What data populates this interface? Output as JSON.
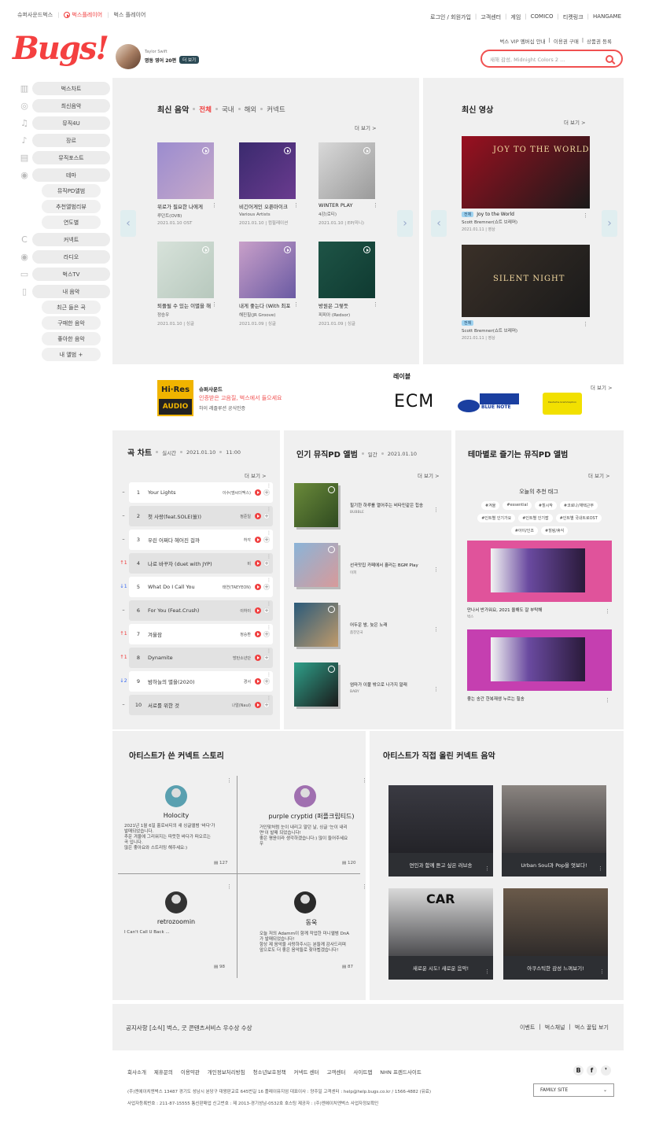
{
  "topnav": {
    "left": [
      "슈퍼사운드벅스",
      "벅스플레이어",
      "벅스 플레이어"
    ],
    "right": [
      "로그인 / 회원가입",
      "고객센터",
      "게임",
      "COMICO",
      "티켓링크",
      "HANGAME"
    ]
  },
  "logo": "Bugs!",
  "vip_links": [
    "벅스 VIP 멤버십 안내",
    "이용권 구매",
    "상품권 등록"
  ],
  "search": {
    "placeholder": "새해 감성, Midnight Colors 2 ..."
  },
  "artist_promo": {
    "name": "Taylor Swift",
    "title": "명동 영어 20편",
    "more": "더 보기"
  },
  "sidebar": [
    {
      "icon": "chart-icon",
      "label": "벅스차트"
    },
    {
      "icon": "disc-icon",
      "label": "최신음악"
    },
    {
      "icon": "note-icon",
      "label": "뮤직4U"
    },
    {
      "icon": "guitar-icon",
      "label": "장르"
    },
    {
      "icon": "post-icon",
      "label": "뮤직포스트"
    },
    {
      "icon": "theme-icon",
      "label": "테마"
    },
    {
      "sub": true,
      "label": "뮤직PD앨범"
    },
    {
      "sub": true,
      "label": "추천앨범리뷰"
    },
    {
      "sub": true,
      "label": "연도별"
    },
    {
      "icon": "connect-icon",
      "label": "커넥트"
    },
    {
      "icon": "radio-icon",
      "label": "라디오"
    },
    {
      "icon": "tv-icon",
      "label": "벅스TV"
    },
    {
      "icon": "folder-icon",
      "label": "내 음악"
    },
    {
      "sub": true,
      "label": "최근 들은 곡"
    },
    {
      "sub": true,
      "label": "구매한 음악"
    },
    {
      "sub": true,
      "label": "좋아한 음악"
    },
    {
      "sub": true,
      "label": "내 앨범 +"
    }
  ],
  "latest": {
    "title": "최신 음악",
    "tabs": [
      "전체",
      "국내",
      "해외",
      "커넥트"
    ],
    "more": "더 보기 >",
    "albums": [
      {
        "title": "위로가 필요한 나에게",
        "artist": "루던트(OVB)",
        "date": "2021.01.10 OST",
        "color1": "#9b8ccf",
        "color2": "#c7a9c9"
      },
      {
        "title": "비긴어게인 오픈마이크",
        "artist": "Various Artists",
        "date": "2021.01.10 | 컴필레이션",
        "color1": "#3a2a6e",
        "color2": "#6a3b8f"
      },
      {
        "title": "WINTER PLAY",
        "artist": "4강(로티)",
        "date": "2021.01.10 | EP(미니)",
        "color1": "#d9d9d9",
        "color2": "#9a9a9a"
      },
      {
        "title": "퇴플될 수 있는 이별을 해",
        "artist": "정승우",
        "date": "2021.01.10 | 싱글",
        "color1": "#d7e2da",
        "color2": "#b7c8bd"
      },
      {
        "title": "내게 좋는다 (With 최포",
        "artist": "해진힐(JR Groove)",
        "date": "2021.01.09 | 싱글",
        "color1": "#c9a0c9",
        "color2": "#6a5aa3"
      },
      {
        "title": "방원은 그렇듯",
        "artist": "피피아 (Redsor)",
        "date": "2021.01.09 | 싱글",
        "color1": "#1e5446",
        "color2": "#0f3a31"
      }
    ]
  },
  "videos": {
    "title": "최신 영상",
    "more": "더 보기 >",
    "items": [
      {
        "badge": "전체",
        "title": "Joy to the World",
        "artist": "Scott Bremner(쇼트 브레머)",
        "date": "2021.01.11 | 영상",
        "thumb_text": "JOY TO THE WORLD",
        "bg": "#9a1020"
      },
      {
        "badge": "전체",
        "title": "",
        "artist": "Scott Bremner(쇼트 브레머)",
        "date": "2021.01.11 | 영상",
        "thumb_text": "SILENT NIGHT",
        "bg": "#3a3028"
      }
    ]
  },
  "label": {
    "title": "레이블",
    "more": "더 보기 >",
    "hires": {
      "line1": "Hi·Res",
      "line2": "AUDIO",
      "name": "슈퍼사운드",
      "desc": "인증받은 고음질, 벅스에서 들으세요",
      "sub": "하이 레졸루션 공식인증"
    },
    "logos": [
      "ECM",
      "BLUE NOTE",
      "Deutsche Grammophon"
    ]
  },
  "chart": {
    "title": "곡 차트",
    "meta": [
      "실시간",
      "2021.01.10",
      "11:00"
    ],
    "more": "더 보기 >",
    "rows": [
      {
        "rank": "1",
        "change": "–",
        "title": "Your Lights",
        "artist": "이수(엠씨더맥스)"
      },
      {
        "rank": "2",
        "change": "–",
        "title": "첫 사랑(feat.SOLE(쏠))",
        "artist": "정준일"
      },
      {
        "rank": "3",
        "change": "–",
        "title": "우린 어쩌다 헤어진 걸까",
        "artist": "허각"
      },
      {
        "rank": "4",
        "change": "↑1",
        "title": "나로 바꾸자 (duet with JYP)",
        "artist": "비"
      },
      {
        "rank": "5",
        "change": "↓1",
        "title": "What Do I Call You",
        "artist": "태연(TAEYEON)"
      },
      {
        "rank": "6",
        "change": "–",
        "title": "For You (Feat.Crush)",
        "artist": "이하이"
      },
      {
        "rank": "7",
        "change": "↑1",
        "title": "겨울잠",
        "artist": "정승환"
      },
      {
        "rank": "8",
        "change": "↑1",
        "title": "Dynamite",
        "artist": "방탄소년단"
      },
      {
        "rank": "9",
        "change": "↓2",
        "title": "밤하늘의 별을(2020)",
        "artist": "경서"
      },
      {
        "rank": "10",
        "change": "–",
        "title": "서로를 위한 것",
        "artist": "나얼(Naul)"
      }
    ]
  },
  "pd": {
    "title": "인기 뮤직PD 앨범",
    "meta": [
      "일간",
      "2021.01.10"
    ],
    "more": "더 보기 >",
    "items": [
      {
        "title": "힐기한 하루를 열어주는 비타민같은 힙송",
        "curator": "BUBBLE",
        "c1": "#6a8a3a",
        "c2": "#2f4a20"
      },
      {
        "title": "선곡맛집 카페에서 흘러는 BGM Play",
        "curator": "이피",
        "c1": "#8ab4d8",
        "c2": "#d89a9a"
      },
      {
        "title": "어두운 밤, 늦은 노래",
        "curator": "춤진민국",
        "c1": "#2a5a7a",
        "c2": "#c09a6a"
      },
      {
        "title": "엄마가 이불 밖으로 나가지 말래",
        "curator": "BABY",
        "c1": "#2fa08a",
        "c2": "#1a1a1a"
      }
    ]
  },
  "theme": {
    "title": "테마별로 즐기는 뮤직PD 앨범",
    "more": "더 보기 >",
    "tag_title": "오늘의 추천 태그",
    "tags": [
      "#겨울",
      "#essential",
      "#힐시작",
      "#코로나/재택근무",
      "#인트별 인기가요",
      "#인트별 인기팝",
      "#인트별 국내트로OST",
      "#아이/인조",
      "#힐링/휴식"
    ],
    "albums": [
      {
        "title": "만나서 반가워요, 2021 올해도 잘 부탁해",
        "curator": "벅스",
        "bg": "#e0539b"
      },
      {
        "title": "좋는 송간 한복재생 누르는 힐송",
        "curator": "",
        "bg": "#c53fb0"
      }
    ]
  },
  "story": {
    "title": "아티스트가 쓴 커넥트 스토리",
    "items": [
      {
        "name": "Holocity",
        "text": "2021년 1월 6일 홀로씨티의 새 싱글앨범 '바다'가\n발매되었습니다.\n추운 겨울에 그리워지는 따뜻한 바다가 떠오르는\n곡 입니다.\n많은 좋아요와 스트리밍 해주세요:)",
        "comments": "127",
        "avbg": "#5aa0b0"
      },
      {
        "name": "purple cryptid (퍼플크립티드)",
        "text": "거인맞처럼 눈이 내리고 말던 날, 싱글 '눈이 내리\n면'이 발매 되었습니다!\n좋은 평윤이라 생각하겠습니다:) 많이 들어주세요\n우",
        "comments": "120",
        "avbg": "#a070b0"
      },
      {
        "name": "retrozoomin",
        "text": "I Can't Call U Back ...",
        "comments": "98",
        "avbg": "#333333"
      },
      {
        "name": "동욱",
        "text": "오늘 저의 Adamm이 함께 작업한 미니앨범 DnA\n가 발매되었습니다!\n항상 제 음악을 사랑하주시는 분들께 감사드리며\n앞으로도 더 좋은 음악들로 찾아뵙겠습니다!",
        "comments": "87",
        "avbg": "#2a2a2a"
      }
    ]
  },
  "connect_music": {
    "title": "아티스트가 직접 올린 커넥트 음악",
    "items": [
      {
        "caption": "연인과 함께 듣고 싶은 러브송",
        "bg": "#3a3a42"
      },
      {
        "caption": "Urban Soul과 Pop을 엇보다!",
        "bg": "#8a8480"
      },
      {
        "caption": "새로운 시도! 새로운 음악!",
        "bg": "#d9d9d9",
        "thumb_text": "CAR"
      },
      {
        "caption": "아쿠스틱한 감성 느껴보기!",
        "bg": "#6a5a4a"
      }
    ]
  },
  "notice": {
    "text": "공지사항 [소식] 벅스, 굿 콘텐츠서비스 우수상 수상",
    "links": [
      "이벤트",
      "벅스채널",
      "벅스 꿀팁 보기"
    ]
  },
  "footer": {
    "links": [
      "회사소개",
      "제휴문의",
      "이용약관",
      "개인정보처리방침",
      "청소년보호정책",
      "커넥트 센터",
      "고객센터",
      "사이트맵",
      "NHN 프렌드사이트"
    ],
    "info1": "(주)엔에이치엔벅스   13487 경기도 성남시 분당구 대왕판교로 645번길 16 플레이뮤지엄   대표이사 : 양주일   고객센터 : help@help.bugs.co.kr / 1566-4882 (유료)",
    "info2": "사업자등록번호 : 211-87-15555   통신판매업 신고번호 : 제 2013-경기성남-0532호   호스팅 제공자 : (주)엔에이치엔벅스   사업자정보확인",
    "family_site": "FAMILY SITE",
    "sns": [
      "B",
      "f",
      "❜"
    ]
  }
}
